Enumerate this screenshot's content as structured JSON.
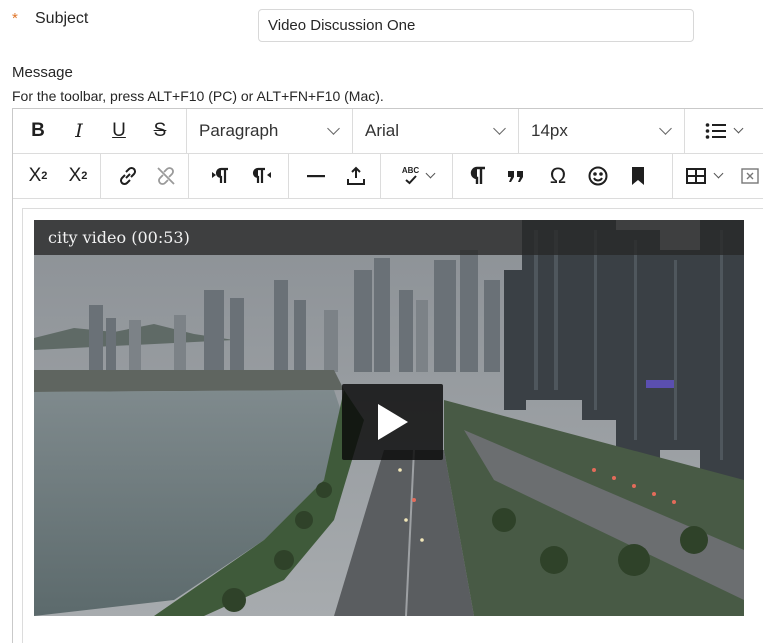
{
  "form": {
    "required_mark": "*",
    "subject_label": "Subject",
    "subject_value": "Video Discussion One",
    "message_label": "Message",
    "toolbar_hint": "For the toolbar, press ALT+F10 (PC) or ALT+FN+F10 (Mac)."
  },
  "toolbar": {
    "row1": {
      "bold": "B",
      "italic": "I",
      "underline": "U",
      "strikethrough": "S",
      "block_format": "Paragraph",
      "font_family": "Arial",
      "font_size": "14px"
    },
    "row2": {
      "superscript_base": "X",
      "superscript_mark": "2",
      "subscript_base": "X",
      "subscript_mark": "2",
      "spellcheck_badge": "ABC",
      "omega": "Ω"
    },
    "icons": {
      "bullet_list": "bullet-list-icon",
      "link": "link-icon",
      "unlink": "unlink-icon",
      "ltr": "ltr-direction-icon",
      "rtl": "rtl-direction-icon",
      "hr": "horizontal-line-icon",
      "insert": "insert-icon",
      "spellcheck": "spellcheck-icon",
      "paragraph_mark": "paragraph-mark-icon",
      "blockquote": "blockquote-icon",
      "special_char": "omega-icon",
      "emoticon": "emoji-icon",
      "bookmark": "bookmark-icon",
      "table": "table-icon",
      "clear": "clear-format-icon"
    }
  },
  "video": {
    "title": "city video (00:53)"
  },
  "colors": {
    "required": "#e0762a",
    "title_bar": "#282828",
    "play_button": "#0a0a0a"
  }
}
